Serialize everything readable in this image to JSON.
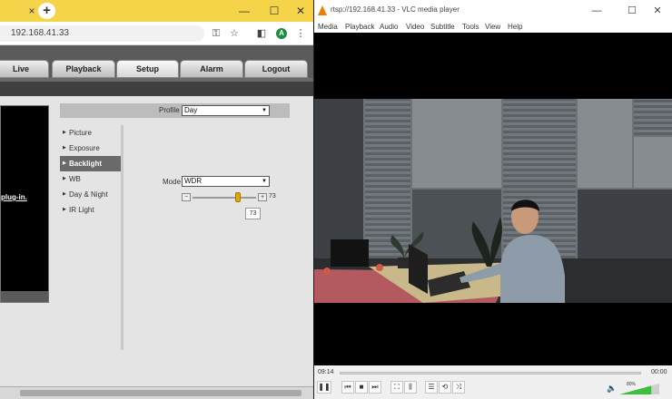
{
  "browser": {
    "tab_close": "×",
    "new_tab": "+",
    "minimize": "—",
    "maximize": "☐",
    "close": "✕",
    "url": "192.168.41.33",
    "avatar_letter": "A",
    "menu_dots": "⋮"
  },
  "camera": {
    "nav_tabs": [
      "Live",
      "Playback",
      "Setup",
      "Alarm",
      "Logout"
    ],
    "active_tab": "Setup",
    "plugin_text": "plug-in.",
    "profile_label": "Profile",
    "profile_value": "Day",
    "sidebar_items": [
      "Picture",
      "Exposure",
      "Backlight",
      "WB",
      "Day & Night",
      "IR Light"
    ],
    "active_item": "Backlight",
    "mode_label": "Mode",
    "mode_value": "WDR",
    "slider_value": 73,
    "slider_value_text": "73",
    "slider_box_text": "73",
    "minus": "−",
    "plus": "+"
  },
  "vlc": {
    "title": "rtsp://192.168.41.33 - VLC media player",
    "minimize": "—",
    "maximize": "☐",
    "close": "✕",
    "menu": [
      "Media",
      "Playback",
      "Audio",
      "Video",
      "Subtitle",
      "Tools",
      "View",
      "Help"
    ],
    "time_elapsed": "09:14",
    "time_total": "00:00",
    "volume_percent": "80%",
    "volume_level": 0.8
  }
}
